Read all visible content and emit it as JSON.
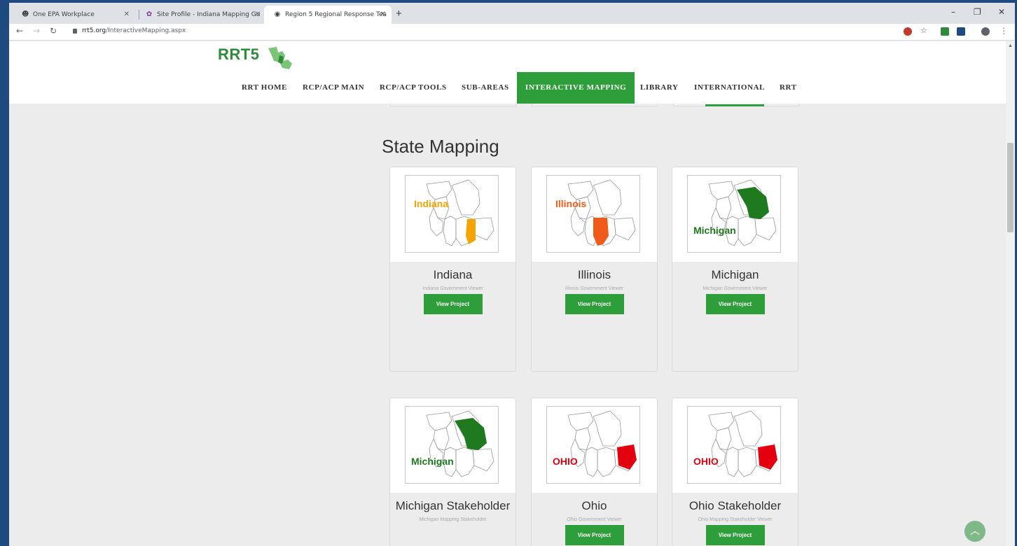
{
  "browser": {
    "tabs": [
      {
        "title": "One EPA Workplace",
        "icon": "people-icon"
      },
      {
        "title": "Site Profile - Indiana Mapping Gu",
        "icon": "epa-icon"
      },
      {
        "title": "Region 5 Regional Response Tea",
        "icon": "globe-icon"
      }
    ],
    "new_tab": "+",
    "url_host": "rrt5.org",
    "url_path": "/InteractiveMapping.aspx",
    "window_controls": {
      "minimize": "–",
      "maximize": "❐",
      "close": "✕"
    }
  },
  "site": {
    "logo_text": "RRT5",
    "nav": [
      {
        "label": "RRT HOME"
      },
      {
        "label": "RCP/ACP MAIN"
      },
      {
        "label": "RCP/ACP TOOLS"
      },
      {
        "label": "SUB-AREAS"
      },
      {
        "label": "INTERACTIVE MAPPING"
      },
      {
        "label": "LIBRARY"
      },
      {
        "label": "INTERNATIONAL"
      },
      {
        "label": "RRT"
      }
    ],
    "active_nav": "INTERACTIVE MAPPING",
    "accent_color": "#2e9e3a"
  },
  "section_title": "State Mapping",
  "cards": [
    {
      "title": "Indiana",
      "subtitle": "Indiana Government Viewer",
      "button": "View Project",
      "map_label": "Indiana",
      "label_color": "#f5a300",
      "state": "indiana",
      "state_color": "#f5a300"
    },
    {
      "title": "Illinois",
      "subtitle": "Illinois Government Viewer",
      "button": "View Project",
      "map_label": "Illinois",
      "label_color": "#f05a1a",
      "state": "illinois",
      "state_color": "#f05a1a"
    },
    {
      "title": "Michigan",
      "subtitle": "Michigan Government Viewer",
      "button": "View Project",
      "map_label": "Michigan",
      "label_color": "#1f7a1f",
      "state": "michigan",
      "state_color": "#1f7a1f"
    },
    {
      "title": "Michigan Stakeholder",
      "subtitle": "Michigan Mapping Stakeholder",
      "button": "",
      "map_label": "Michigan",
      "label_color": "#1f7a1f",
      "state": "michigan",
      "state_color": "#1f7a1f"
    },
    {
      "title": "Ohio",
      "subtitle": "Ohio Government Viewer",
      "button": "View Project",
      "map_label": "OHIO",
      "label_color": "#e3000f",
      "state": "ohio",
      "state_color": "#e3000f"
    },
    {
      "title": "Ohio Stakeholder",
      "subtitle": "Ohio Mapping Stakeholder Viewer",
      "button": "View Project",
      "map_label": "OHIO",
      "label_color": "#e3000f",
      "state": "ohio",
      "state_color": "#e3000f"
    }
  ]
}
